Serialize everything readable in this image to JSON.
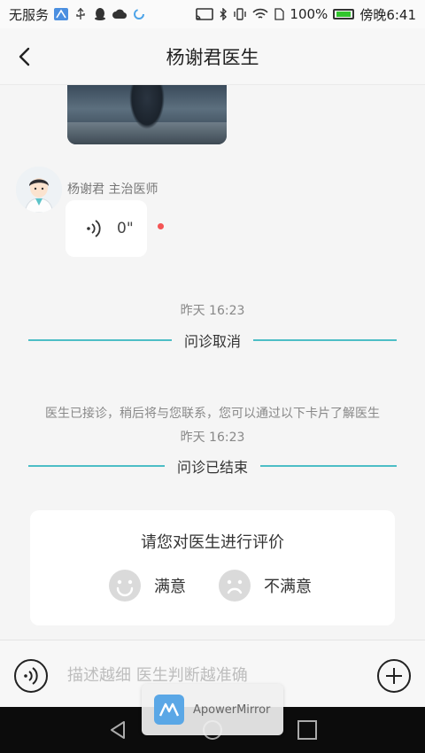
{
  "status_bar": {
    "carrier": "无服务",
    "battery_percent": "100%",
    "time": "傍晚6:41"
  },
  "header": {
    "title": "杨谢君医生"
  },
  "chat": {
    "doctor_label": "杨谢君  主治医师",
    "voice_duration": "0\"",
    "time_1": "昨天 16:23",
    "divider_1": "问诊取消",
    "notice": "医生已接诊，稍后将与您联系，您可以通过以下卡片了解医生",
    "time_2": "昨天 16:23",
    "divider_2": "问诊已结束"
  },
  "rating": {
    "title": "请您对医生进行评价",
    "satisfied": "满意",
    "unsatisfied": "不满意"
  },
  "input_bar": {
    "placeholder": "描述越细 医生判断越准确"
  },
  "overlay": {
    "label": "ApowerMirror"
  },
  "colors": {
    "accent_line": "#4dbec6",
    "unread_dot": "#f45454"
  }
}
